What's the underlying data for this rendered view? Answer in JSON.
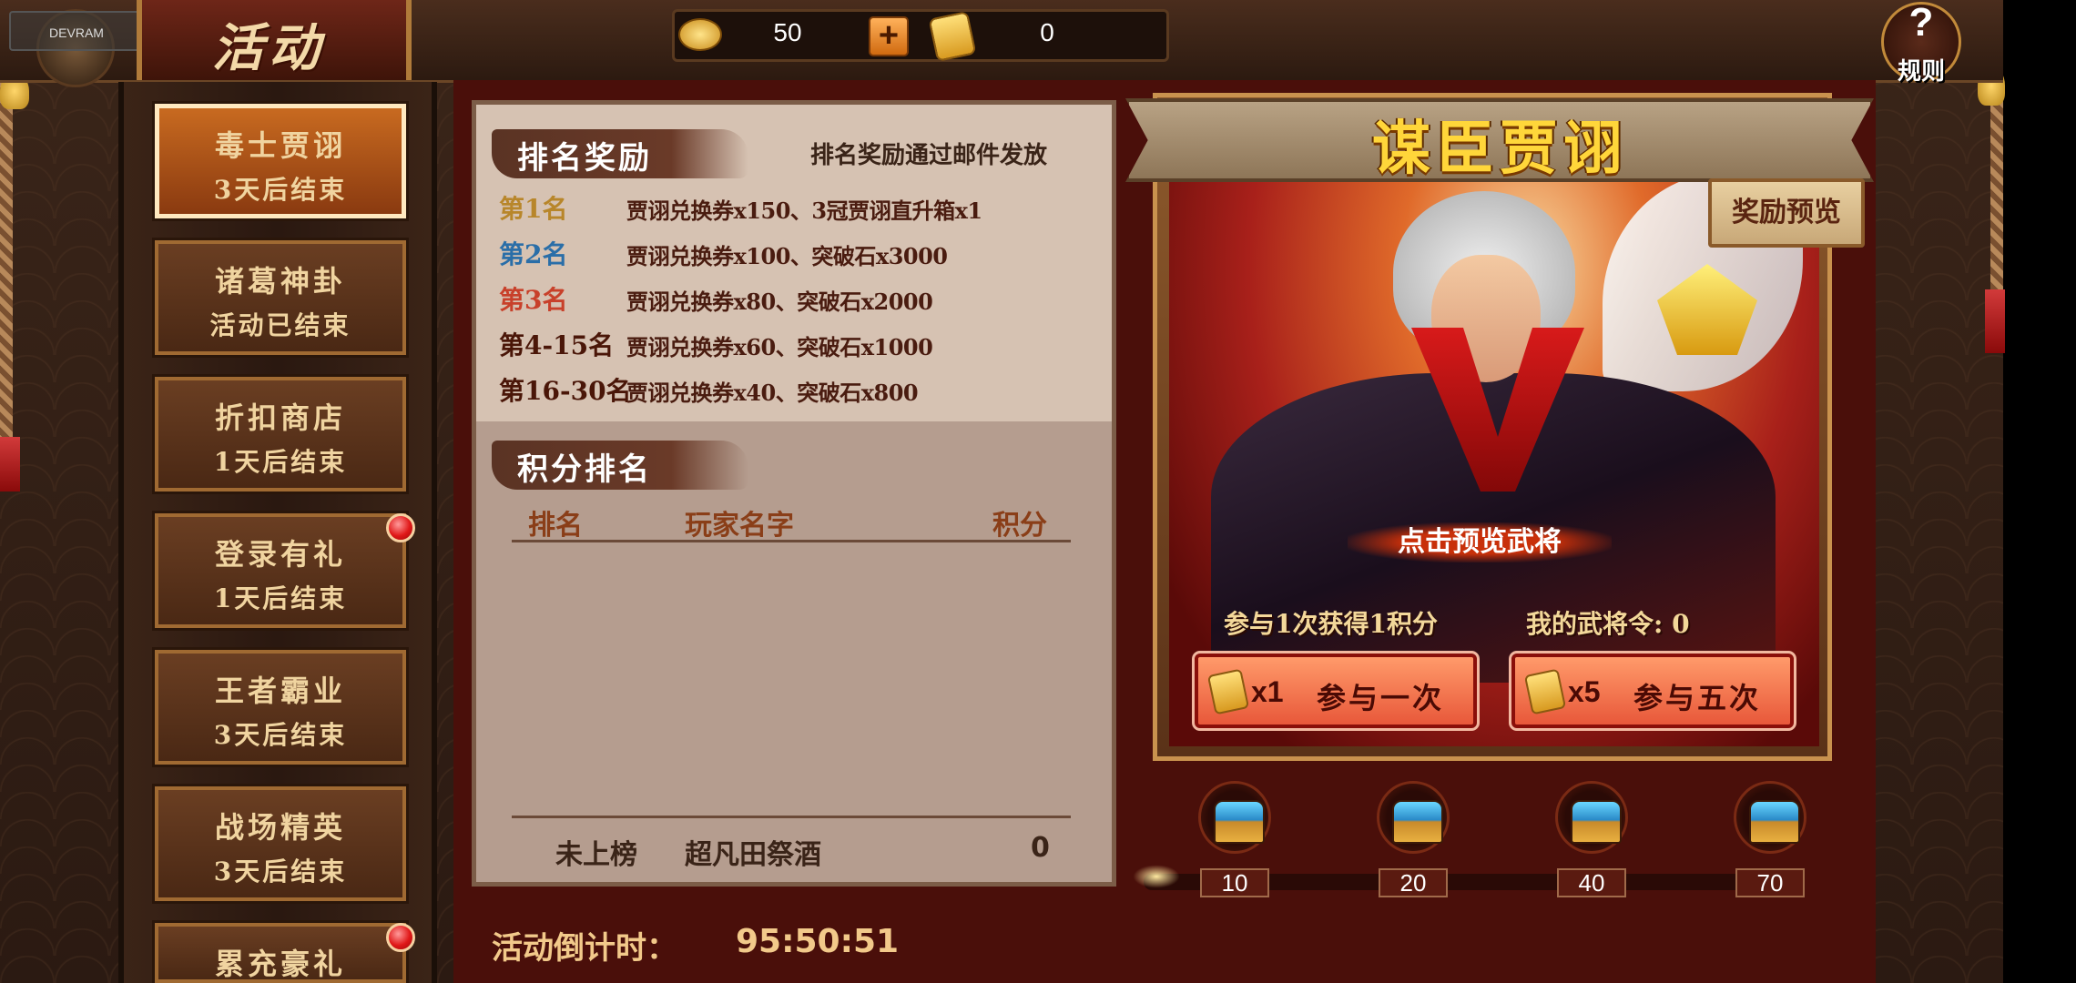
{
  "header": {
    "title": "活动",
    "debug_label": "DEVRAM",
    "gold_value": "50",
    "token_value": "0",
    "help_label": "规则",
    "help_glyph": "?"
  },
  "tabs": [
    {
      "name": "毒士贾诩",
      "status": "3天后结束",
      "active": true,
      "badge": false
    },
    {
      "name": "诸葛神卦",
      "status": "活动已结束",
      "active": false,
      "badge": false
    },
    {
      "name": "折扣商店",
      "status": "1天后结束",
      "active": false,
      "badge": false
    },
    {
      "name": "登录有礼",
      "status": "1天后结束",
      "active": false,
      "badge": true
    },
    {
      "name": "王者霸业",
      "status": "3天后结束",
      "active": false,
      "badge": false
    },
    {
      "name": "战场精英",
      "status": "3天后结束",
      "active": false,
      "badge": false
    },
    {
      "name": "累充豪礼",
      "status": "",
      "active": false,
      "badge": true
    }
  ],
  "rank_rewards": {
    "title": "排名奖励",
    "note": "排名奖励通过邮件发放",
    "rows": [
      {
        "rank": "第1名",
        "reward": "贾诩兑换券x150、3冠贾诩直升箱x1",
        "color": "#b8862a"
      },
      {
        "rank": "第2名",
        "reward": "贾诩兑换券x100、突破石x3000",
        "color": "#2a6ea8"
      },
      {
        "rank": "第3名",
        "reward": "贾诩兑换券x80、突破石x2000",
        "color": "#c8402a"
      },
      {
        "rank": "第4-15名",
        "reward": "贾诩兑换券x60、突破石x1000",
        "color": "#4a1608"
      },
      {
        "rank": "第16-30名",
        "reward": "贾诩兑换券x40、突破石x800",
        "color": "#4a1608"
      }
    ]
  },
  "score_ranking": {
    "title": "积分排名",
    "columns": [
      "排名",
      "玩家名字",
      "积分"
    ],
    "rows": [],
    "my_row": {
      "rank": "未上榜",
      "name": "超凡田祭酒",
      "score": "0"
    }
  },
  "countdown": {
    "label": "活动倒计时：",
    "value": "95:50:51"
  },
  "hero": {
    "banner_title": "谋臣贾诩",
    "preview_button": "奖励预览",
    "click_preview": "点击预览武将",
    "participate_info": "参与1次获得1积分",
    "my_tokens": "我的武将令: 0",
    "join_once": {
      "multiplier": "x1",
      "label": "参与一次"
    },
    "join_five": {
      "multiplier": "x5",
      "label": "参与五次"
    }
  },
  "milestones": {
    "progress": 0.0,
    "values": [
      "10",
      "20",
      "40",
      "70"
    ]
  }
}
